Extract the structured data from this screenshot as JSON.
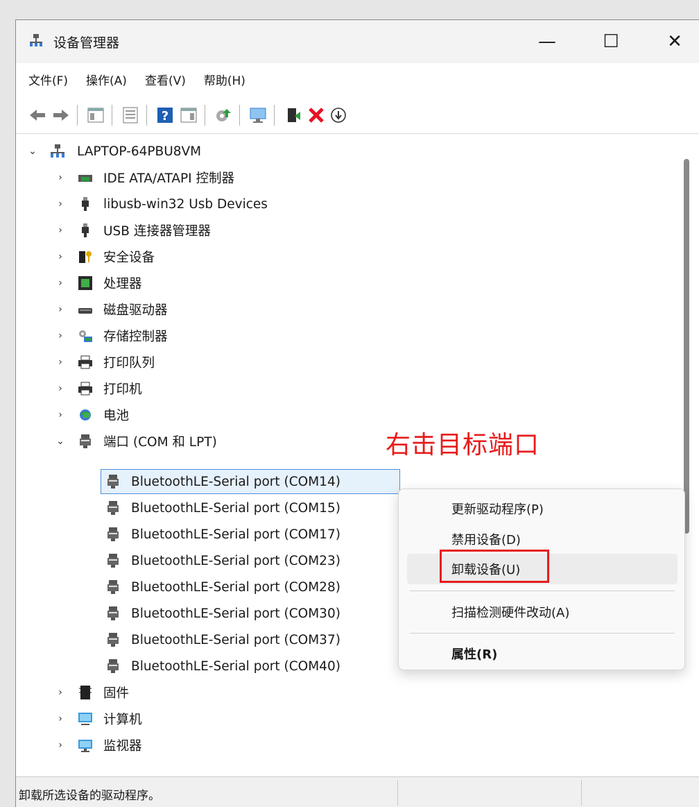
{
  "window": {
    "title": "设备管理器",
    "controls": {
      "minimize": "—",
      "maximize": "☐",
      "close": "✕"
    }
  },
  "menu": [
    "文件(F)",
    "操作(A)",
    "查看(V)",
    "帮助(H)"
  ],
  "toolbar_icons": [
    "back-icon",
    "forward-icon",
    "show-hide-console-tree-icon",
    "properties-icon",
    "help-icon",
    "action-pane-icon",
    "update-driver-icon",
    "scan-hardware-icon",
    "enable-device-icon",
    "uninstall-device-icon",
    "download-driver-icon"
  ],
  "tree": {
    "root": "LAPTOP-64PBU8VM",
    "categories_top": [
      {
        "label": "IDE ATA/ATAPI 控制器",
        "icon": "ide-controller-icon"
      },
      {
        "label": "libusb-win32 Usb Devices",
        "icon": "usb-plug-icon"
      },
      {
        "label": "USB 连接器管理器",
        "icon": "usb-plug-icon"
      },
      {
        "label": "安全设备",
        "icon": "security-key-icon"
      },
      {
        "label": "处理器",
        "icon": "processor-icon"
      },
      {
        "label": "磁盘驱动器",
        "icon": "disk-drive-icon"
      },
      {
        "label": "存储控制器",
        "icon": "storage-controller-icon"
      },
      {
        "label": "打印队列",
        "icon": "printer-icon"
      },
      {
        "label": "打印机",
        "icon": "printer-icon"
      },
      {
        "label": "电池",
        "icon": "battery-icon"
      }
    ],
    "ports_category": {
      "label": "端口 (COM 和 LPT)",
      "expanded": true
    },
    "ports": [
      "BluetoothLE-Serial port (COM14)",
      "BluetoothLE-Serial port (COM15)",
      "BluetoothLE-Serial port (COM17)",
      "BluetoothLE-Serial port (COM23)",
      "BluetoothLE-Serial port (COM28)",
      "BluetoothLE-Serial port (COM30)",
      "BluetoothLE-Serial port (COM37)",
      "BluetoothLE-Serial port (COM40)"
    ],
    "selected_port": "BluetoothLE-Serial port (COM14)",
    "categories_bottom": [
      {
        "label": "固件",
        "icon": "firmware-icon"
      },
      {
        "label": "计算机",
        "icon": "computer-icon"
      },
      {
        "label": "监视器",
        "icon": "monitor-icon"
      }
    ]
  },
  "annotation": "右击目标端口",
  "context_menu": {
    "items": [
      "更新驱动程序(P)",
      "禁用设备(D)",
      "卸载设备(U)",
      "扫描检测硬件改动(A)",
      "属性(R)"
    ],
    "highlighted": "卸载设备(U)",
    "default_item": "属性(R)"
  },
  "status_bar": {
    "text": "卸载所选设备的驱动程序。"
  },
  "colors": {
    "accent_red": "#e81c1c",
    "selection_border": "#4a90d9",
    "selection_fill": "#e5f1fb"
  }
}
